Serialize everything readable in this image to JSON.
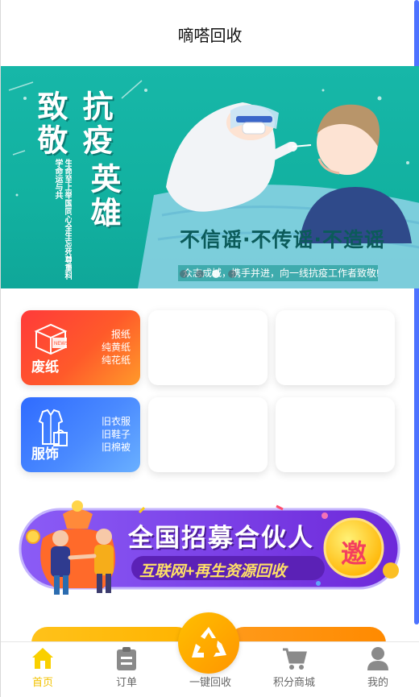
{
  "header": {
    "title": "嘀嗒回收"
  },
  "banner": {
    "title_line1": "致敬",
    "title_line2": "抗疫",
    "title_line3": "英雄",
    "vertical_caption": "生命至上举国同心全生忘死尊重科学命运与共",
    "slogan": "不信谣·不传谣·不造谣",
    "subtitle": "众志成城，携手并进，向一线抗疫工作者致敬!",
    "dots_count": 4,
    "active_dot": 3
  },
  "categories": [
    {
      "title": "废纸",
      "items": [
        "报纸",
        "纯黄纸",
        "纯花纸"
      ],
      "dots": "......",
      "color": "#ff4a2e",
      "icon": "paper-box-icon"
    },
    {
      "title": "服饰",
      "items": [
        "旧衣服",
        "旧鞋子",
        "旧棉被"
      ],
      "dots": "......",
      "color": "#3a7bff",
      "icon": "clothes-icon"
    }
  ],
  "recruit": {
    "headline": "全国招募合伙人",
    "sub": "互联网+再生资源回收",
    "badge": "邀",
    "color": "#7c3aed"
  },
  "tabbar": {
    "items": [
      {
        "label": "首页",
        "icon": "home-icon",
        "active": true
      },
      {
        "label": "订单",
        "icon": "order-icon",
        "active": false
      },
      {
        "label": "一键回收",
        "icon": "recycle-icon",
        "active": false
      },
      {
        "label": "积分商城",
        "icon": "cart-icon",
        "active": false
      },
      {
        "label": "我的",
        "icon": "user-icon",
        "active": false
      }
    ],
    "active_color": "#f2c200"
  }
}
